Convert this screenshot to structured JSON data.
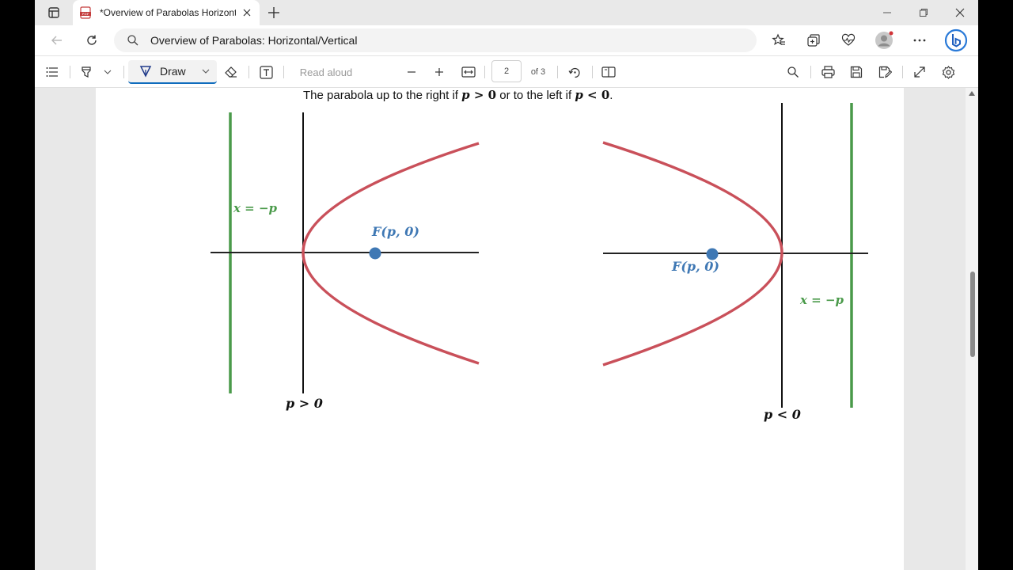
{
  "browser": {
    "tab_title": "*Overview of Parabolas Horizonta",
    "address": "Overview of Parabolas: Horizontal/Vertical"
  },
  "pdf_toolbar": {
    "draw_label": "Draw",
    "read_aloud_label": "Read aloud",
    "page_number": "2",
    "page_total": "of 3"
  },
  "document": {
    "caption_pre": "The parabola up to the right if ",
    "caption_cond1": "p > ",
    "caption_zero1": "0",
    "caption_mid": " or to the left if ",
    "caption_cond2": "p < ",
    "caption_zero2": "0",
    "caption_end": ".",
    "left_graph": {
      "directrix_label": "x = −p",
      "focus_label": "F(p, 0)",
      "condition_label": "p > 0"
    },
    "right_graph": {
      "directrix_label": "x = −p",
      "focus_label": "F(p, 0)",
      "condition_label": "p < 0"
    }
  },
  "colors": {
    "parabola": "#c9505a",
    "directrix": "#4a9a4a",
    "focus": "#3f78b4",
    "axis": "#1a1a1a"
  }
}
